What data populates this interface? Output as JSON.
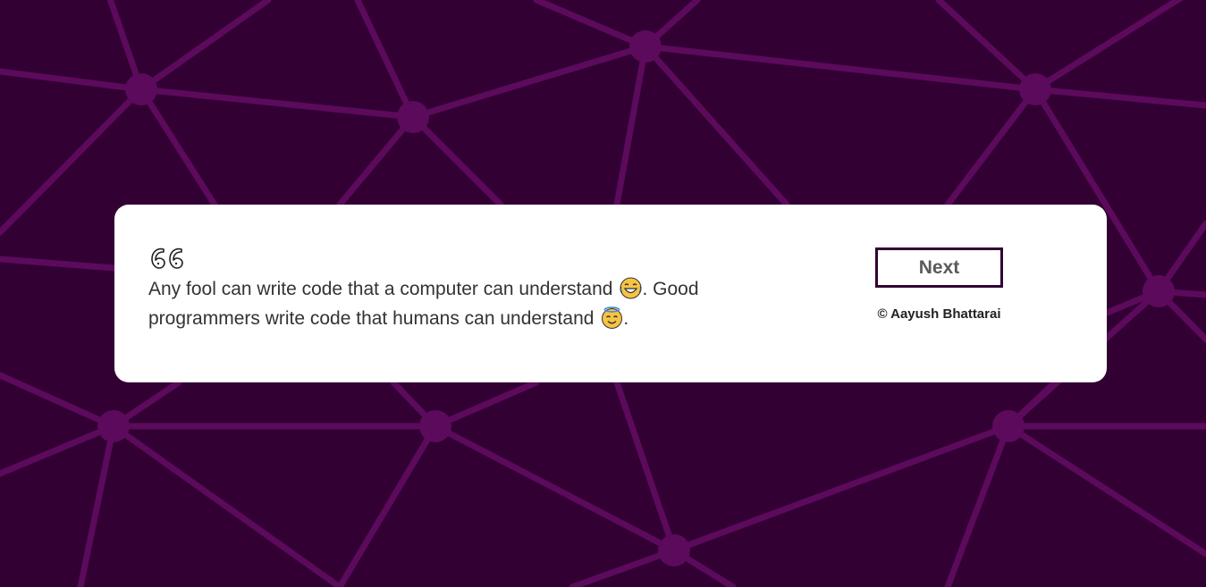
{
  "background": {
    "color": "#330033",
    "line_color": "#5c0a5c",
    "node_color": "#5c0a5c"
  },
  "quote": {
    "icon": "quote-open-icon",
    "text_part1": "Any fool can write code that a computer can understand",
    "emoji1": "laughing-tears-emoji-icon",
    "text_part2": ". Good programmers write code that humans can understand",
    "emoji2": "smiling-halo-emoji-icon",
    "text_part3": "."
  },
  "actions": {
    "next_label": "Next"
  },
  "credit": {
    "text": "© Aayush Bhattarai"
  },
  "colors": {
    "accent": "#330033",
    "button_text": "#5a5a5a",
    "card_background": "#ffffff"
  }
}
